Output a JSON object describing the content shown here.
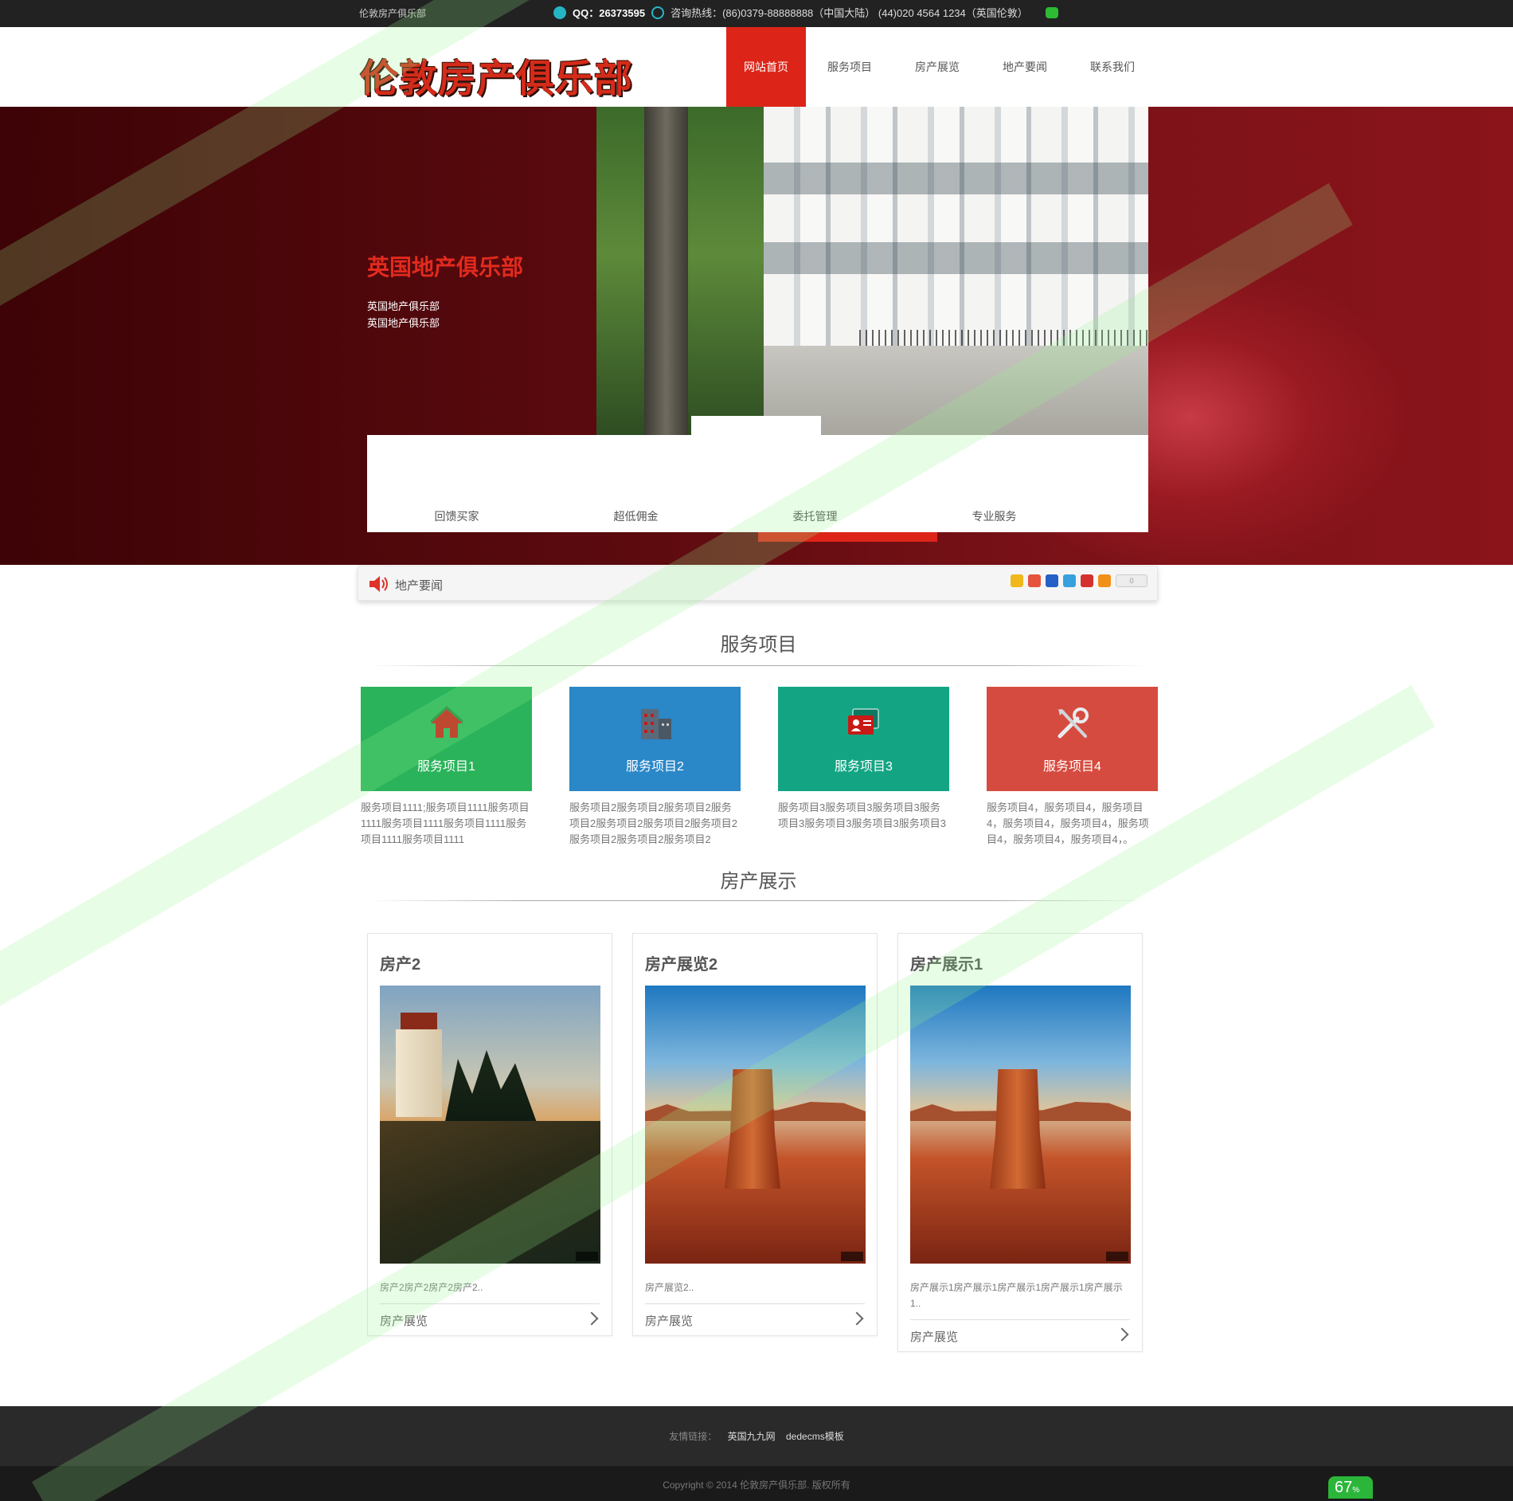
{
  "topbar": {
    "site_name": "伦敦房产俱乐部",
    "qq": "QQ：26373595",
    "hotline": "咨询热线：(86)0379-88888888（中国大陆） (44)020 4564 1234（英国伦敦）"
  },
  "header": {
    "logo_text": "伦敦房产俱乐部",
    "nav": [
      {
        "label": "网站首页",
        "active": true
      },
      {
        "label": "服务项目",
        "active": false
      },
      {
        "label": "房产展览",
        "active": false
      },
      {
        "label": "地产要闻",
        "active": false
      },
      {
        "label": "联系我们",
        "active": false
      }
    ]
  },
  "banner": {
    "title": "英国地产俱乐部",
    "sub_lines": [
      "英国地产俱乐部",
      "英国地产俱乐部"
    ],
    "features": [
      "回馈买家",
      "超低佣金",
      "委托管理",
      "专业服务"
    ],
    "active_feature": 2
  },
  "notice": {
    "label": "地产要闻",
    "share_icons": [
      "qzone-icon",
      "weibo-icon",
      "baidu-icon",
      "tencent-icon",
      "renren-icon",
      "more-share-icon"
    ],
    "share_count": "0"
  },
  "services": {
    "title": "服务项目",
    "items": [
      {
        "label": "服务项目1",
        "icon": "house-icon",
        "color": "#2ab35a",
        "desc": "服务项目1111;服务项目1111服务项目1111服务项目1111服务项目1111服务项目1111服务项目1111"
      },
      {
        "label": "服务项目2",
        "icon": "building-icon",
        "color": "#2a87c8",
        "desc": "服务项目2服务项目2服务项目2服务项目2服务项目2服务项目2服务项目2服务项目2服务项目2服务项目2"
      },
      {
        "label": "服务项目3",
        "icon": "id-card-icon",
        "color": "#13a583",
        "desc": "服务项目3服务项目3服务项目3服务项目3服务项目3服务项目3服务项目3"
      },
      {
        "label": "服务项目4",
        "icon": "tools-icon",
        "color": "#d64b3f",
        "desc": "服务项目4，服务项目4，服务项目4，服务项目4，服务项目4，服务项目4，服务项目4，服务项目4，。"
      }
    ]
  },
  "showcase": {
    "title": "房产展示",
    "cards": [
      {
        "title": "房产2",
        "desc": "房产2房产2房产2房产2..",
        "link": "房产展览"
      },
      {
        "title": "房产展览2",
        "desc": "房产展览2..",
        "link": "房产展览"
      },
      {
        "title": "房产展示1",
        "desc": "房产展示1房产展示1房产展示1房产展示1房产展示1..",
        "link": "房产展览"
      }
    ]
  },
  "footer": {
    "links_label": "友情链接：",
    "links": [
      "英国九九网",
      "dedecms模板"
    ],
    "copyright": "Copyright © 2014 伦敦房产俱乐部. 版权所有"
  },
  "zoom_badge": "67",
  "zoom_unit": "%",
  "colors": {
    "accent_red": "#dc2518",
    "topbar": "#222222",
    "footer": "#2a2a2a"
  }
}
